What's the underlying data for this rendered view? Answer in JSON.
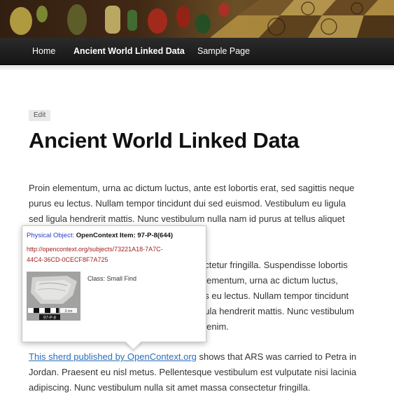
{
  "nav": {
    "items": [
      {
        "label": "Home"
      },
      {
        "label": "Ancient World Linked Data"
      },
      {
        "label": "Sample Page"
      }
    ]
  },
  "page": {
    "edit_label": "Edit",
    "title": "Ancient World Linked Data"
  },
  "paragraph1": {
    "lines": [
      "Proin elementum, urna ac dictum luctus, ante est lobortis erat, sed sagittis neque",
      "purus eu lectus. Nullam tempor tincidunt dui sed euismod. Vestibulum eu ligula",
      "sed ligula hendrerit mattis. Nunc vestibulum nulla nam id purus at tellus aliquet"
    ]
  },
  "paragraph2": {
    "lines": [
      "ectetur fringilla. Suspendisse lobortis",
      "elementum, urna ac dictum luctus,",
      "us eu lectus. Nullam tempor tincidunt",
      "gula hendrerit mattis. Nunc vestibulum",
      "c enim."
    ]
  },
  "paragraph3": {
    "link_text": "This sherd published by OpenContext.org",
    "line1_rest": " shows that ARS was carried to Petra in",
    "lines": [
      "Jordan. Praesent eu nisl metus. Pellentesque vestibulum est vulputate nisi lacinia",
      "adipiscing. Nunc vestibulum nulla sit amet massa consectetur fringilla."
    ]
  },
  "popup": {
    "type_label": "Physical Object:",
    "title": "OpenContext Item: 97-P-8(644)",
    "url_lines": [
      "http://opencontext.org/subjects/73221A18-7A7C-",
      "44C4-36CD-0CECF8F7A725"
    ],
    "class_text": "Class: Small Find",
    "thumb_label": "97-P-8",
    "scale_label": "3 cm"
  }
}
